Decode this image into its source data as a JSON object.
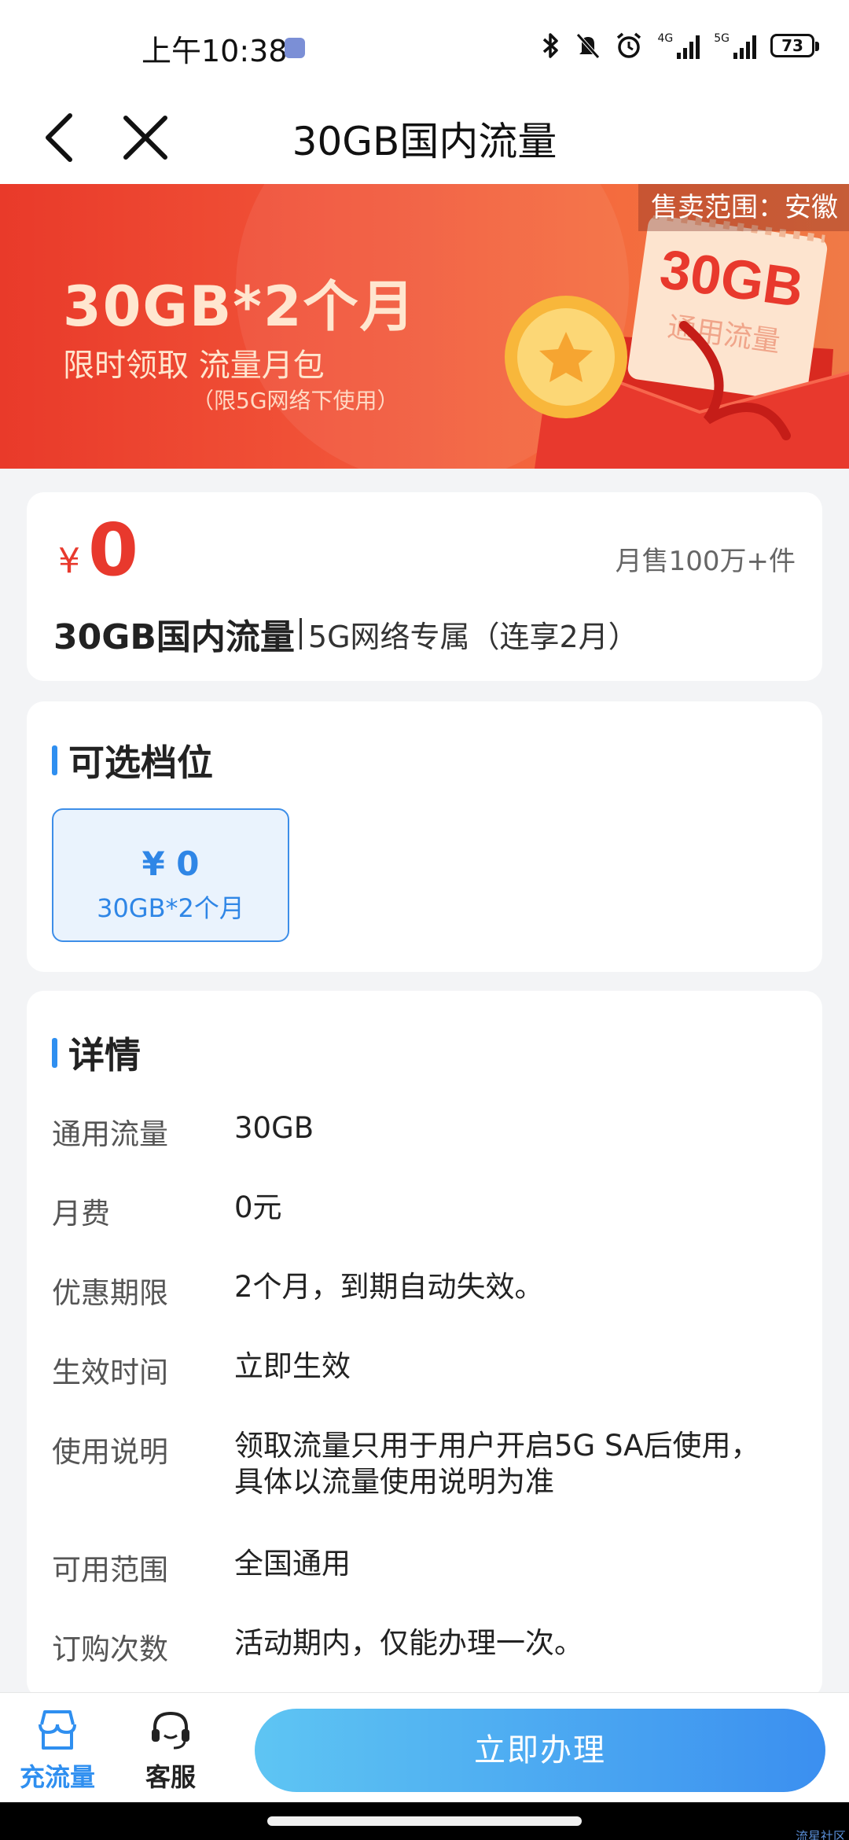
{
  "status_bar": {
    "time": "上午10:38",
    "network_1": "4G",
    "network_2": "5G",
    "battery": "73"
  },
  "nav": {
    "title": "30GB国内流量"
  },
  "banner": {
    "scope": "售卖范围：安徽",
    "headline": "30GB*2个月",
    "subtitle": "限时领取 流量月包",
    "note": "（限5G网络下使用）",
    "art_amount": "30GB",
    "art_label": "通用流量"
  },
  "price_card": {
    "currency": "¥",
    "price": "0",
    "monthly_sales": "月售100万+件",
    "product_name": "30GB国内流量",
    "product_desc": "5G网络专属（连享2月）"
  },
  "tiers": {
    "title": "可选档位",
    "options": [
      {
        "price": "¥ 0",
        "label": "30GB*2个月"
      }
    ]
  },
  "details": {
    "title": "详情",
    "rows": [
      {
        "key": "通用流量",
        "value": "30GB"
      },
      {
        "key": "月费",
        "value": "0元"
      },
      {
        "key": "优惠期限",
        "value": "2个月，到期自动失效。"
      },
      {
        "key": "生效时间",
        "value": "立即生效"
      },
      {
        "key": "使用说明",
        "value": "领取流量只用于用户开启5G SA后使用，",
        "value_2": "具体以流量使用说明为准"
      },
      {
        "key": "可用范围",
        "value": "全国通用"
      },
      {
        "key": "订购次数",
        "value": "活动期内，仅能办理一次。"
      }
    ]
  },
  "bottom_bar": {
    "tab_recharge": "充流量",
    "tab_service": "客服",
    "apply_button": "立即办理"
  },
  "watermark": "流星社区",
  "colors": {
    "accent_blue": "#2f8ff0",
    "price_red": "#e8392d",
    "banner_orange": "#f2573a"
  }
}
